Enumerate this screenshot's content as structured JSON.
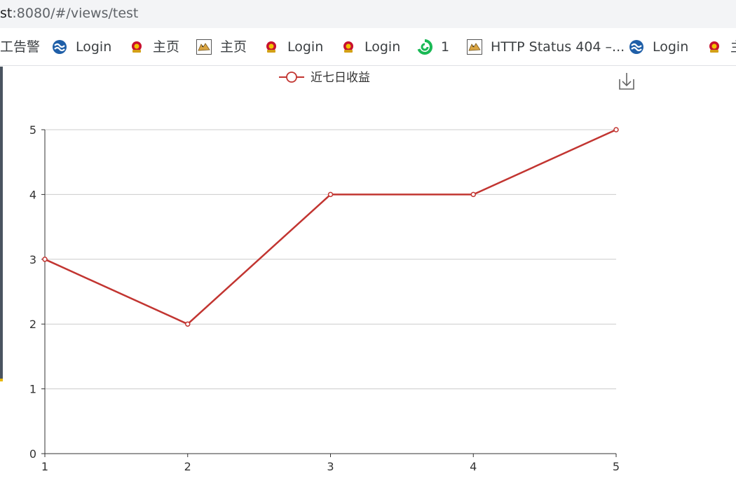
{
  "browser": {
    "url_host": "st",
    "url_rest": ":8080/#/views/test"
  },
  "bookmarks": [
    {
      "label": "工告警",
      "icon": "none"
    },
    {
      "label": "Login",
      "icon": "swirl-blue-icon"
    },
    {
      "label": "主页",
      "icon": "police-emblem-icon"
    },
    {
      "label": "主页",
      "icon": "tomcat-icon"
    },
    {
      "label": "Login",
      "icon": "police-emblem-icon"
    },
    {
      "label": "Login",
      "icon": "police-emblem-icon"
    },
    {
      "label": "1",
      "icon": "green-swirl-icon"
    },
    {
      "label": "HTTP Status 404 –...",
      "icon": "tomcat-icon"
    },
    {
      "label": "Login",
      "icon": "swirl-blue-icon"
    },
    {
      "label": "主",
      "icon": "police-emblem-icon"
    }
  ],
  "toolbox": {
    "download_icon": "download-icon"
  },
  "chart_data": {
    "type": "line",
    "legend_position": "top-center",
    "x": [
      1,
      2,
      3,
      4,
      5
    ],
    "series": [
      {
        "name": "近七日收益",
        "values": [
          3,
          2,
          4,
          4,
          5
        ],
        "color": "#c23531"
      }
    ],
    "ylim": [
      0,
      5
    ],
    "yticks": [
      0,
      1,
      2,
      3,
      4,
      5
    ],
    "xticks": [
      1,
      2,
      3,
      4,
      5
    ],
    "grid": "horizontal"
  }
}
